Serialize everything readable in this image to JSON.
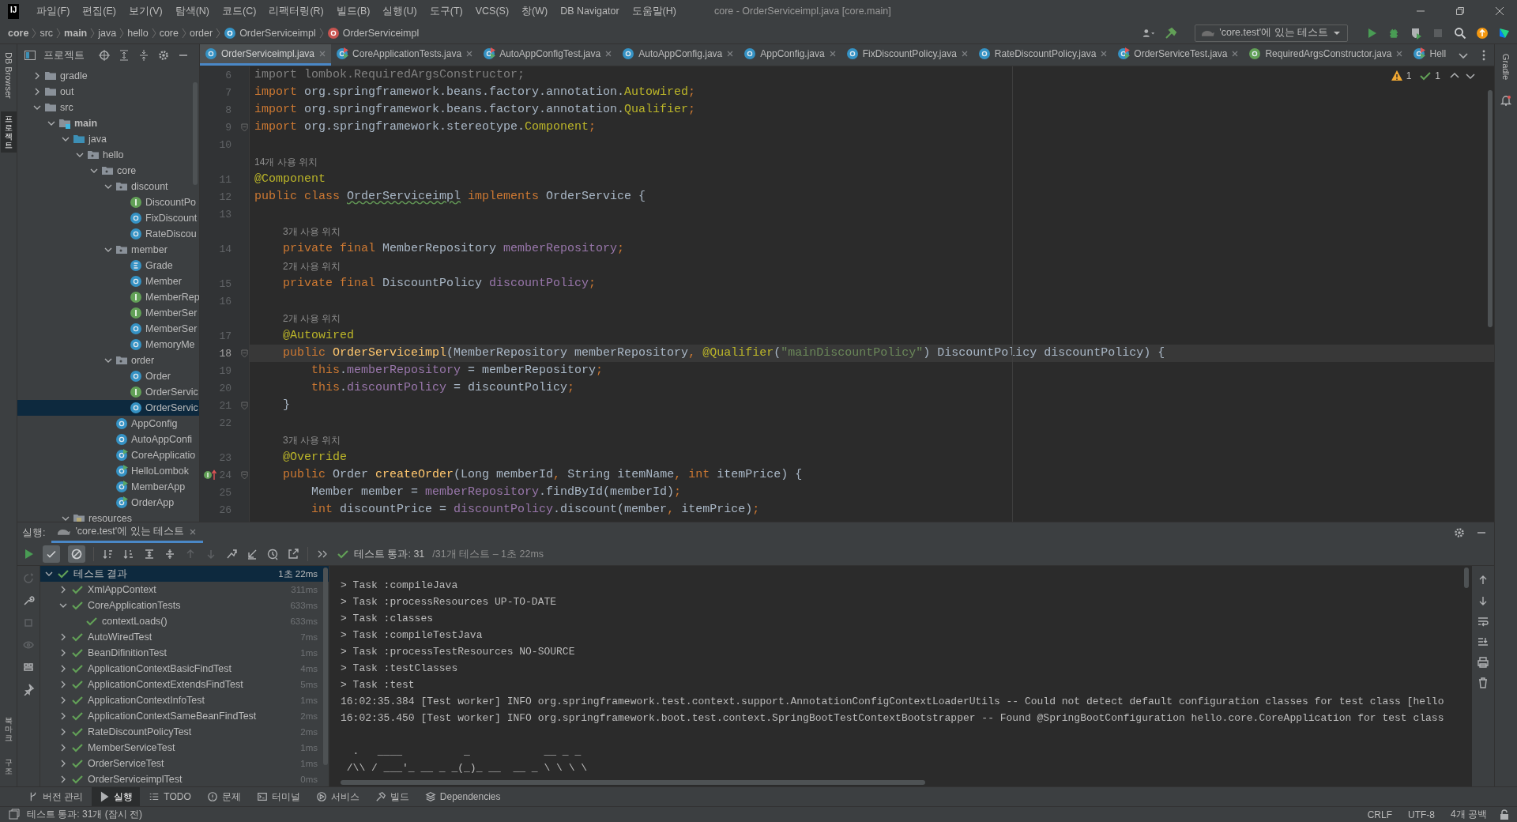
{
  "menu_bar": {
    "logo": "IJ",
    "items": [
      "파일(F)",
      "편집(E)",
      "보기(V)",
      "탐색(N)",
      "코드(C)",
      "리팩터링(R)",
      "빌드(B)",
      "실행(U)",
      "도구(T)",
      "VCS(S)",
      "창(W)",
      "DB Navigator",
      "도움말(H)"
    ],
    "title": "core - OrderServiceimpl.java [core.main]"
  },
  "breadcrumbs": [
    {
      "text": "core",
      "kind": "folder",
      "bold": true
    },
    {
      "text": "src",
      "kind": "folder",
      "bold": false
    },
    {
      "text": "main",
      "kind": "folder",
      "bold": true
    },
    {
      "text": "java",
      "kind": "folder",
      "bold": false
    },
    {
      "text": "hello",
      "kind": "folder",
      "bold": false
    },
    {
      "text": "core",
      "kind": "folder",
      "bold": false
    },
    {
      "text": "order",
      "kind": "folder",
      "bold": false
    },
    {
      "text": "OrderServiceimpl",
      "kind": "class",
      "bold": false
    },
    {
      "text": "OrderServiceimpl",
      "kind": "method",
      "bold": false
    }
  ],
  "run_config": "'core.test'에 있는 테스트",
  "left_strip": {
    "top": [
      {
        "label": "DB Browser",
        "kind": "latin",
        "selected": false
      },
      {
        "label": "프로젝트",
        "kind": "hangul",
        "selected": true
      }
    ],
    "bottom": [
      {
        "label": "북마크",
        "kind": "hangul",
        "selected": false
      },
      {
        "label": "구조",
        "kind": "hangul",
        "selected": false
      }
    ]
  },
  "right_strip": {
    "top": [
      {
        "label": "Gradle",
        "selected": false
      }
    ]
  },
  "project_panel": {
    "title": "프로젝트",
    "tree": [
      {
        "label": "gradle",
        "kind": "folder",
        "expanded": false,
        "selected": false
      },
      {
        "label": "out",
        "kind": "folder",
        "expanded": false,
        "selected": false
      },
      {
        "label": "src",
        "kind": "folder",
        "expanded": true,
        "selected": false,
        "children": [
          {
            "label": "main",
            "kind": "source-root",
            "expanded": true,
            "selected": false,
            "children": [
              {
                "label": "java",
                "kind": "source-folder",
                "expanded": true,
                "selected": false,
                "children": [
                  {
                    "label": "hello",
                    "kind": "package",
                    "expanded": true,
                    "selected": false,
                    "children": [
                      {
                        "label": "core",
                        "kind": "package",
                        "expanded": true,
                        "selected": false,
                        "children": [
                          {
                            "label": "discount",
                            "kind": "package",
                            "expanded": true,
                            "selected": false,
                            "children": [
                              {
                                "label": "DiscountPo",
                                "kind": "interface",
                                "selected": false
                              },
                              {
                                "label": "FixDiscount",
                                "kind": "class",
                                "selected": false
                              },
                              {
                                "label": "RateDiscou",
                                "kind": "class",
                                "selected": false
                              }
                            ]
                          },
                          {
                            "label": "member",
                            "kind": "package",
                            "expanded": true,
                            "selected": false,
                            "children": [
                              {
                                "label": "Grade",
                                "kind": "enum",
                                "selected": false
                              },
                              {
                                "label": "Member",
                                "kind": "class",
                                "selected": false
                              },
                              {
                                "label": "MemberRep",
                                "kind": "interface",
                                "selected": false
                              },
                              {
                                "label": "MemberSer",
                                "kind": "interface",
                                "selected": false
                              },
                              {
                                "label": "MemberSer",
                                "kind": "class",
                                "selected": false
                              },
                              {
                                "label": "MemoryMe",
                                "kind": "class",
                                "selected": false
                              }
                            ]
                          },
                          {
                            "label": "order",
                            "kind": "package",
                            "expanded": true,
                            "selected": false,
                            "children": [
                              {
                                "label": "Order",
                                "kind": "class",
                                "selected": false
                              },
                              {
                                "label": "OrderServic",
                                "kind": "interface",
                                "selected": false
                              },
                              {
                                "label": "OrderServic",
                                "kind": "class",
                                "selected": true
                              }
                            ]
                          },
                          {
                            "label": "AppConfig",
                            "kind": "class",
                            "selected": false
                          },
                          {
                            "label": "AutoAppConfi",
                            "kind": "class",
                            "selected": false
                          },
                          {
                            "label": "CoreApplicatio",
                            "kind": "app",
                            "selected": false
                          },
                          {
                            "label": "HelloLombok",
                            "kind": "app",
                            "selected": false
                          },
                          {
                            "label": "MemberApp",
                            "kind": "app",
                            "selected": false
                          },
                          {
                            "label": "OrderApp",
                            "kind": "app",
                            "selected": false
                          }
                        ]
                      }
                    ]
                  }
                ]
              },
              {
                "label": "resources",
                "kind": "resources",
                "expanded": true,
                "selected": false
              }
            ]
          }
        ]
      }
    ]
  },
  "editor": {
    "tabs": [
      {
        "label": "OrderServiceimpl.java",
        "kind": "class",
        "selected": true,
        "closable": true
      },
      {
        "label": "CoreApplicationTests.java",
        "kind": "test-class",
        "selected": false,
        "closable": true
      },
      {
        "label": "AutoAppConfigTest.java",
        "kind": "test-class",
        "selected": false,
        "closable": true
      },
      {
        "label": "AutoAppConfig.java",
        "kind": "class",
        "selected": false,
        "closable": true
      },
      {
        "label": "AppConfig.java",
        "kind": "class",
        "selected": false,
        "closable": true
      },
      {
        "label": "FixDiscountPolicy.java",
        "kind": "class",
        "selected": false,
        "closable": true
      },
      {
        "label": "RateDiscountPolicy.java",
        "kind": "class",
        "selected": false,
        "closable": true
      },
      {
        "label": "OrderServiceTest.java",
        "kind": "test-class",
        "selected": false,
        "closable": true
      },
      {
        "label": "RequiredArgsConstructor.java",
        "kind": "annotation",
        "selected": false,
        "closable": true
      },
      {
        "label": "Hell",
        "kind": "test-class",
        "selected": false,
        "closable": false
      }
    ],
    "inspections": {
      "warnings": "1",
      "weak_warnings": "1"
    },
    "lines": [
      {
        "kind": "code",
        "number": "6",
        "tokens": [
          {
            "kind": "unused",
            "text": "import lombok.RequiredArgsConstructor;"
          }
        ]
      },
      {
        "kind": "code",
        "number": "7",
        "tokens": [
          {
            "kind": "keyword",
            "text": "import "
          },
          {
            "kind": "plain",
            "text": "org.springframework.beans.factory.annotation."
          },
          {
            "kind": "annotation",
            "text": "Autowired"
          },
          {
            "kind": "keyword",
            "text": ";"
          }
        ]
      },
      {
        "kind": "code",
        "number": "8",
        "tokens": [
          {
            "kind": "keyword",
            "text": "import "
          },
          {
            "kind": "plain",
            "text": "org.springframework.beans.factory.annotation."
          },
          {
            "kind": "annotation",
            "text": "Qualifier"
          },
          {
            "kind": "keyword",
            "text": ";"
          }
        ]
      },
      {
        "kind": "code",
        "number": "9",
        "fold": true,
        "tokens": [
          {
            "kind": "keyword",
            "text": "import "
          },
          {
            "kind": "plain",
            "text": "org.springframework.stereotype."
          },
          {
            "kind": "annotation",
            "text": "Component"
          },
          {
            "kind": "keyword",
            "text": ";"
          }
        ]
      },
      {
        "kind": "code",
        "number": "10"
      },
      {
        "kind": "hint",
        "text": "14개 사용 위치",
        "nested": false
      },
      {
        "kind": "code",
        "number": "11",
        "tokens": [
          {
            "kind": "annotation",
            "text": "@Component"
          }
        ]
      },
      {
        "kind": "code",
        "number": "12",
        "tokens": [
          {
            "kind": "keyword",
            "text": "public class "
          },
          {
            "kind": "typo",
            "text": "OrderServiceimpl"
          },
          {
            "kind": "keyword",
            "text": " implements "
          },
          {
            "kind": "plain",
            "text": "OrderService {"
          }
        ]
      },
      {
        "kind": "code",
        "number": "13"
      },
      {
        "kind": "hint",
        "text": "3개 사용 위치",
        "nested": true
      },
      {
        "kind": "code",
        "number": "14",
        "tokens": [
          {
            "kind": "keyword",
            "text": "    private final "
          },
          {
            "kind": "plain",
            "text": "MemberRepository "
          },
          {
            "kind": "field",
            "text": "memberRepository"
          },
          {
            "kind": "keyword",
            "text": ";"
          }
        ]
      },
      {
        "kind": "hint",
        "text": "2개 사용 위치",
        "nested": true
      },
      {
        "kind": "code",
        "number": "15",
        "tokens": [
          {
            "kind": "keyword",
            "text": "    private final "
          },
          {
            "kind": "plain",
            "text": "DiscountPolicy "
          },
          {
            "kind": "field",
            "text": "discountPolicy"
          },
          {
            "kind": "keyword",
            "text": ";"
          }
        ]
      },
      {
        "kind": "code",
        "number": "16"
      },
      {
        "kind": "hint",
        "text": "2개 사용 위치",
        "nested": true
      },
      {
        "kind": "code",
        "number": "17",
        "tokens": [
          {
            "kind": "annotation",
            "text": "    @Autowired"
          }
        ]
      },
      {
        "kind": "code",
        "number": "18",
        "current": true,
        "fold": true,
        "tokens": [
          {
            "kind": "keyword",
            "text": "    public "
          },
          {
            "kind": "method",
            "text": "OrderServiceimpl"
          },
          {
            "kind": "plain",
            "text": "(MemberRepository memberRepository"
          },
          {
            "kind": "keyword",
            "text": ", "
          },
          {
            "kind": "annotation",
            "text": "@Qualifier"
          },
          {
            "kind": "plain",
            "text": "("
          },
          {
            "kind": "string",
            "text": "\"mainDiscountPolicy\""
          },
          {
            "kind": "plain",
            "text": ") DiscountPolicy discountPolicy) {"
          }
        ]
      },
      {
        "kind": "code",
        "number": "19",
        "tokens": [
          {
            "kind": "keyword",
            "text": "        this"
          },
          {
            "kind": "plain",
            "text": "."
          },
          {
            "kind": "field",
            "text": "memberRepository"
          },
          {
            "kind": "plain",
            "text": " = memberRepository"
          },
          {
            "kind": "keyword",
            "text": ";"
          }
        ]
      },
      {
        "kind": "code",
        "number": "20",
        "tokens": [
          {
            "kind": "keyword",
            "text": "        this"
          },
          {
            "kind": "plain",
            "text": "."
          },
          {
            "kind": "field",
            "text": "discountPolicy"
          },
          {
            "kind": "plain",
            "text": " = discountPolicy"
          },
          {
            "kind": "keyword",
            "text": ";"
          }
        ]
      },
      {
        "kind": "code",
        "number": "21",
        "fold": true,
        "tokens": [
          {
            "kind": "plain",
            "text": "    }"
          }
        ]
      },
      {
        "kind": "code",
        "number": "22"
      },
      {
        "kind": "hint",
        "text": "3개 사용 위치",
        "nested": true
      },
      {
        "kind": "code",
        "number": "23",
        "tokens": [
          {
            "kind": "annotation",
            "text": "    @Override"
          }
        ]
      },
      {
        "kind": "code",
        "number": "24",
        "fold": true,
        "marker": true,
        "tokens": [
          {
            "kind": "keyword",
            "text": "    public "
          },
          {
            "kind": "plain",
            "text": "Order "
          },
          {
            "kind": "method",
            "text": "createOrder"
          },
          {
            "kind": "plain",
            "text": "(Long memberId"
          },
          {
            "kind": "keyword",
            "text": ", "
          },
          {
            "kind": "plain",
            "text": "String itemName"
          },
          {
            "kind": "keyword",
            "text": ", int "
          },
          {
            "kind": "plain",
            "text": "itemPrice) {"
          }
        ]
      },
      {
        "kind": "code",
        "number": "25",
        "tokens": [
          {
            "kind": "plain",
            "text": "        Member member = "
          },
          {
            "kind": "field",
            "text": "memberRepository"
          },
          {
            "kind": "plain",
            "text": ".findById(memberId)"
          },
          {
            "kind": "keyword",
            "text": ";"
          }
        ]
      },
      {
        "kind": "code",
        "number": "26",
        "tokens": [
          {
            "kind": "keyword",
            "text": "        int "
          },
          {
            "kind": "plain",
            "text": "discountPrice = "
          },
          {
            "kind": "field",
            "text": "discountPolicy"
          },
          {
            "kind": "plain",
            "text": ".discount(member"
          },
          {
            "kind": "keyword",
            "text": ", "
          },
          {
            "kind": "plain",
            "text": "itemPrice)"
          },
          {
            "kind": "keyword",
            "text": ";"
          }
        ]
      }
    ]
  },
  "run_panel": {
    "label": "실행:",
    "tab": "'core.test'에 있는 테스트",
    "toggles": [
      {
        "kind": "passed",
        "selected": true
      },
      {
        "kind": "ignored",
        "selected": true
      }
    ],
    "summary": "테스트 통과: 31",
    "summary_detail": "/31개 테스트 – 1초 22ms",
    "tests": [
      {
        "label": "테스트 결과",
        "time": "1초 22ms",
        "passed": true,
        "expanded": true,
        "selected": true,
        "children": [
          {
            "label": "XmlAppContext",
            "time": "311ms",
            "passed": true,
            "expanded": false,
            "selected": false
          },
          {
            "label": "CoreApplicationTests",
            "time": "633ms",
            "passed": true,
            "expanded": true,
            "selected": false,
            "children": [
              {
                "label": "contextLoads()",
                "time": "633ms",
                "passed": true,
                "selected": false
              }
            ]
          },
          {
            "label": "AutoWiredTest",
            "time": "7ms",
            "passed": true,
            "expanded": false,
            "selected": false
          },
          {
            "label": "BeanDifinitionTest",
            "time": "1ms",
            "passed": true,
            "expanded": false,
            "selected": false
          },
          {
            "label": "ApplicationContextBasicFindTest",
            "time": "4ms",
            "passed": true,
            "expanded": false,
            "selected": false
          },
          {
            "label": "ApplicationContextExtendsFindTest",
            "time": "5ms",
            "passed": true,
            "expanded": false,
            "selected": false
          },
          {
            "label": "ApplicationContextInfoTest",
            "time": "1ms",
            "passed": true,
            "expanded": false,
            "selected": false
          },
          {
            "label": "ApplicationContextSameBeanFindTest",
            "time": "2ms",
            "passed": true,
            "expanded": false,
            "selected": false
          },
          {
            "label": "RateDiscountPolicyTest",
            "time": "2ms",
            "passed": true,
            "expanded": false,
            "selected": false
          },
          {
            "label": "MemberServiceTest",
            "time": "1ms",
            "passed": true,
            "expanded": false,
            "selected": false
          },
          {
            "label": "OrderServiceTest",
            "time": "1ms",
            "passed": true,
            "expanded": false,
            "selected": false
          },
          {
            "label": "OrderServiceimplTest",
            "time": "0ms",
            "passed": true,
            "expanded": false,
            "selected": false
          }
        ]
      }
    ],
    "console": [
      "> Task :compileJava",
      "> Task :processResources UP-TO-DATE",
      "> Task :classes",
      "> Task :compileTestJava",
      "> Task :processTestResources NO-SOURCE",
      "> Task :testClasses",
      "> Task :test",
      "16:02:35.384 [Test worker] INFO org.springframework.test.context.support.AnnotationConfigContextLoaderUtils -- Could not detect default configuration classes for test class [hello",
      "16:02:35.450 [Test worker] INFO org.springframework.boot.test.context.SpringBootTestContextBootstrapper -- Found @SpringBootConfiguration hello.core.CoreApplication for test class"
    ],
    "banner": [
      "  .   ____          _            __ _ _",
      " /\\\\ / ___'_ __ _ _(_)_ __  __ _ \\ \\ \\ \\"
    ]
  },
  "tool_tabs": [
    {
      "label": "버전 관리",
      "kind": "vcs",
      "selected": false
    },
    {
      "label": "실행",
      "kind": "run",
      "selected": true
    },
    {
      "label": "TODO",
      "kind": "todo",
      "selected": false
    },
    {
      "label": "문제",
      "kind": "problems",
      "selected": false
    },
    {
      "label": "터미널",
      "kind": "terminal",
      "selected": false
    },
    {
      "label": "서비스",
      "kind": "services",
      "selected": false
    },
    {
      "label": "빌드",
      "kind": "build",
      "selected": false
    },
    {
      "label": "Dependencies",
      "kind": "dependencies",
      "selected": false
    }
  ],
  "status_bar": {
    "message": "테스트 통과: 31개 (잠시 전)",
    "items": [
      "CRLF",
      "UTF-8",
      "4개 공백"
    ]
  }
}
